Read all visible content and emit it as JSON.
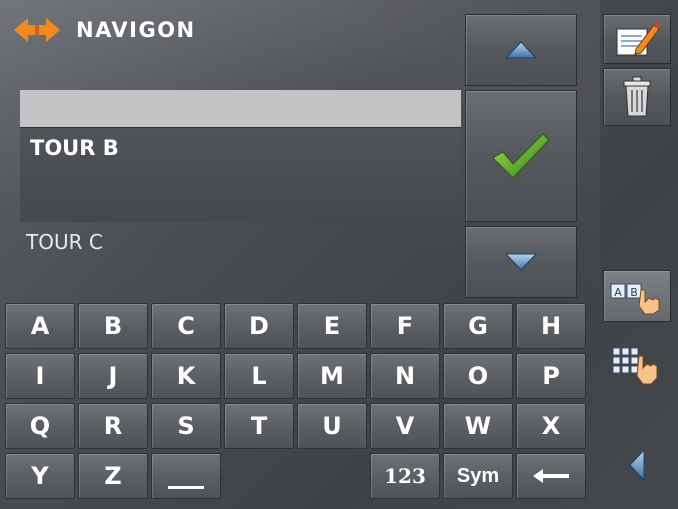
{
  "brand": {
    "name": "NAVIGON"
  },
  "list": {
    "items": [
      {
        "label": ""
      },
      {
        "label": "TOUR B"
      },
      {
        "label": "TOUR C"
      }
    ],
    "selected_index": 1
  },
  "keyboard": {
    "row1": [
      "A",
      "B",
      "C",
      "D",
      "E",
      "F",
      "G",
      "H"
    ],
    "row2": [
      "I",
      "J",
      "K",
      "L",
      "M",
      "N",
      "O",
      "P"
    ],
    "row3": [
      "Q",
      "R",
      "S",
      "T",
      "U",
      "V",
      "W",
      "X"
    ],
    "row4": [
      "Y",
      "Z",
      "",
      "",
      "",
      "123",
      "Sym",
      ""
    ],
    "space_icon": "underscore-space-icon",
    "backspace_icon": "backspace-arrow-icon"
  },
  "icons": {
    "scroll_up": "triangle-up-icon",
    "confirm": "checkmark-icon",
    "scroll_down": "triangle-down-icon",
    "edit": "notepad-pencil-icon",
    "delete": "trash-can-icon",
    "abc_mode": "ab-hand-icon",
    "numpad_mode": "keypad-hand-icon",
    "back": "triangle-left-icon"
  },
  "colors": {
    "accent_orange": "#f08a1e",
    "check_green": "#5aa52a",
    "arrow_blue": "#3f6fa8"
  }
}
